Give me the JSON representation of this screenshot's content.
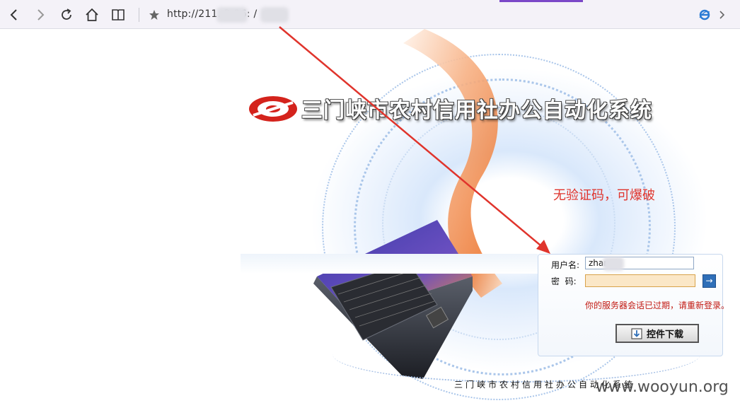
{
  "browser": {
    "url": "http://211.      2.26:     /",
    "url_visible_parts": [
      "http://211.",
      "2.26:",
      "/"
    ],
    "icons": [
      "back-icon",
      "forward-icon",
      "refresh-icon",
      "home-icon",
      "reading-view-icon",
      "favorite-star-icon",
      "ie-logo-icon",
      "chevron-right-icon"
    ]
  },
  "page": {
    "system_title": "三门峡市农村信用社办公自动化系统",
    "annotation": "无验证码，可爆破",
    "login": {
      "username_label": "用户名:",
      "username_value": "zhan",
      "password_label": "密  码:",
      "password_value": "",
      "go_label": "→",
      "message": "你的服务器会话已过期，请重新登录。",
      "download_label": "控件下载"
    },
    "footer_title": "三门峡市农村信用社办公自动化系统",
    "watermark": "www.wooyun.org"
  },
  "colors": {
    "annotation": "#e0342c",
    "message": "#c21a12",
    "arrow": "#e0342c",
    "tab_accent": "#7b48c8"
  }
}
